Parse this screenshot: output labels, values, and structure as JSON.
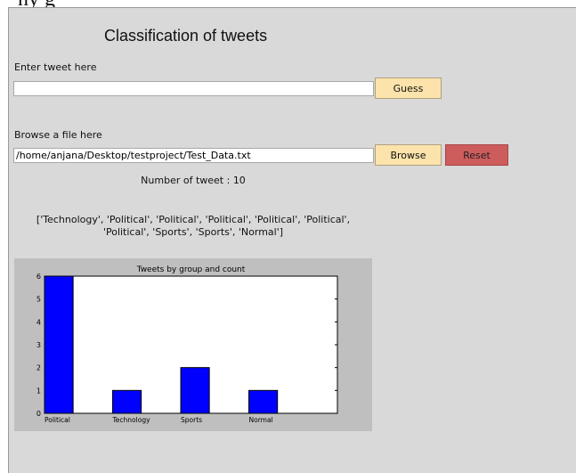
{
  "page": {
    "top_fragment": "ny g"
  },
  "app": {
    "title": "Classification of tweets",
    "tweet_label": "Enter tweet here",
    "tweet_value": "",
    "guess_label": "Guess",
    "file_label": "Browse a file here",
    "file_path": "/home/anjana/Desktop/testproject/Test_Data.txt",
    "browse_label": "Browse",
    "reset_label": "Reset",
    "count_text": "Number of tweet : 10",
    "result_line1": "['Technology', 'Political', 'Political', 'Political', 'Political', 'Political',",
    "result_line2": "'Political', 'Sports', 'Sports', 'Normal']"
  },
  "colors": {
    "window_bg": "#d9d9d9",
    "button_light": "#fbe3ab",
    "button_reset": "#cd5c5c",
    "bar": "#0000ff"
  },
  "chart_data": {
    "type": "bar",
    "title": "Tweets by group and count",
    "categories": [
      "Political",
      "Technology",
      "Sports",
      "Normal"
    ],
    "values": [
      6,
      1,
      2,
      1
    ],
    "xlabel": "",
    "ylabel": "",
    "ylim": [
      0,
      6
    ],
    "yticks": [
      0,
      1,
      2,
      3,
      4,
      5,
      6
    ],
    "grid": false
  }
}
